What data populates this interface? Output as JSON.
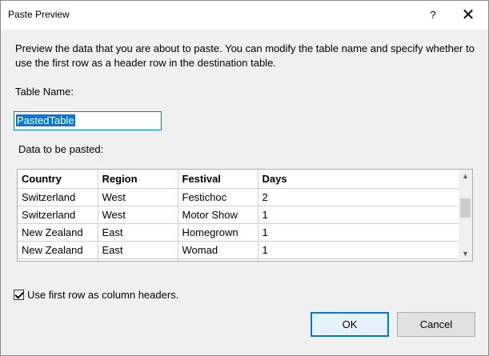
{
  "window": {
    "title": "Paste Preview",
    "help_glyph": "?",
    "close_glyph": "✕"
  },
  "description": "Preview the data that you are about to paste. You can modify the table name and specify whether to use the first row as a header row in the destination table.",
  "table_name": {
    "label": "Table Name:",
    "value": "PastedTable"
  },
  "data_section": {
    "label": "Data to be pasted:",
    "columns": [
      "Country",
      "Region",
      "Festival",
      "Days"
    ],
    "rows": [
      [
        "Switzerland",
        "West",
        "Festichoc",
        "2"
      ],
      [
        "Switzerland",
        "West",
        "Motor Show",
        "1"
      ],
      [
        "New Zealand",
        "East",
        "Homegrown",
        "1"
      ],
      [
        "New Zealand",
        "East",
        "Womad",
        "1"
      ]
    ]
  },
  "checkbox": {
    "label": "Use first row as column headers.",
    "checked": true
  },
  "buttons": {
    "ok": "OK",
    "cancel": "Cancel"
  },
  "scrollbar": {
    "up_icon": "▲",
    "down_icon": "▼"
  }
}
